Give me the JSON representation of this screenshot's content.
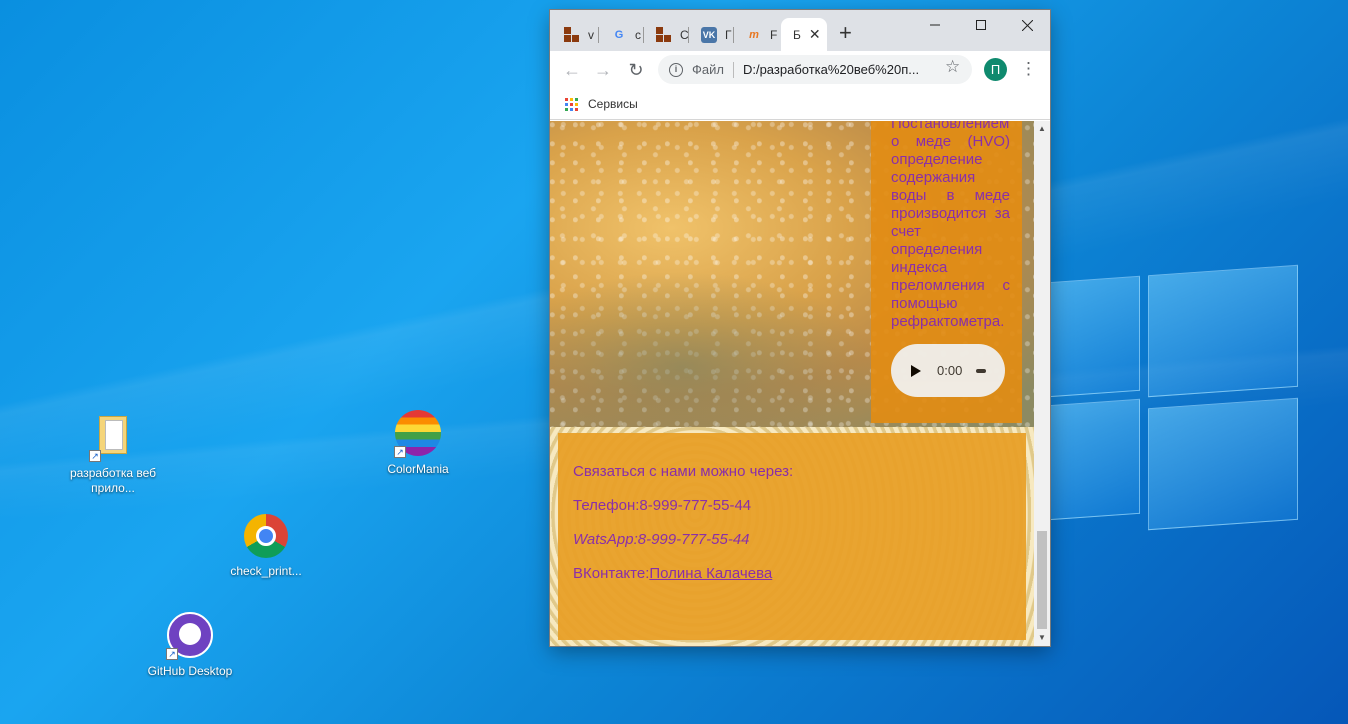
{
  "desktop": {
    "icons": [
      {
        "label": "разработка веб прило..."
      },
      {
        "label": "ColorMania"
      },
      {
        "label": "check_print..."
      },
      {
        "label": "GitHub Desktop"
      }
    ]
  },
  "browser": {
    "tabs": [
      {
        "title": "v",
        "icon": "brick-favicon"
      },
      {
        "title": "c",
        "icon": "google-favicon"
      },
      {
        "title": "С",
        "icon": "brick-favicon"
      },
      {
        "title": "Г",
        "icon": "vk-favicon"
      },
      {
        "title": "F",
        "icon": "fm-favicon"
      },
      {
        "title": "Б",
        "icon": "page-favicon",
        "active": true
      }
    ],
    "new_tab_label": "+",
    "address": {
      "scheme_label": "Файл",
      "url": "D:/разработка%20веб%20п..."
    },
    "profile_initial": "П",
    "bookmarks": {
      "apps_label": "Сервисы"
    }
  },
  "page": {
    "info_text": "Постановлением о меде (HVO) определение содержания воды в меде производится за счет определения индекса преломления с помощью рефрактометра.",
    "audio_time": "0:00",
    "contact": {
      "intro": "Связаться с нами можно через:",
      "phone": "Телефон:8-999-777-55-44",
      "whatsapp": "WatsApp:8-999-777-55-44",
      "vk_prefix": "ВКонтакте:",
      "vk_link": "Полина Калачева"
    }
  },
  "colors": {
    "page_text": "#8a2fa8",
    "info_box": "#e28c14",
    "contact_box": "#e8a028"
  }
}
